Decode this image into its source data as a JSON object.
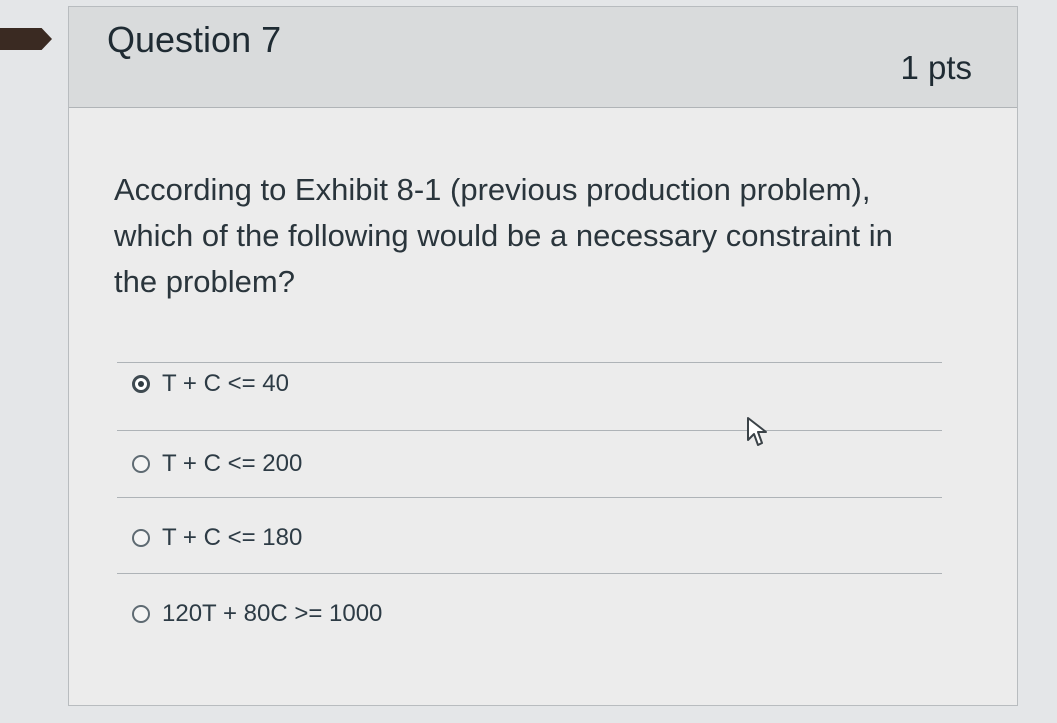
{
  "question": {
    "title": "Question 7",
    "points": "1 pts",
    "text": "According to Exhibit 8-1 (previous production problem), which of the following would be a necessary constraint in the problem?"
  },
  "answers": [
    {
      "label": "T + C <= 40",
      "selected": true
    },
    {
      "label": "T + C <= 200",
      "selected": false
    },
    {
      "label": "T + C <= 180",
      "selected": false
    },
    {
      "label": "120T + 80C >= 1000",
      "selected": false
    }
  ],
  "icons": {
    "flag": "flag-marker-icon",
    "cursor": "mouse-pointer-icon"
  },
  "colors": {
    "header_bg": "#d9dbdc",
    "card_bg": "#ececec",
    "text": "#2d3b45",
    "flag": "#3a2a22"
  }
}
